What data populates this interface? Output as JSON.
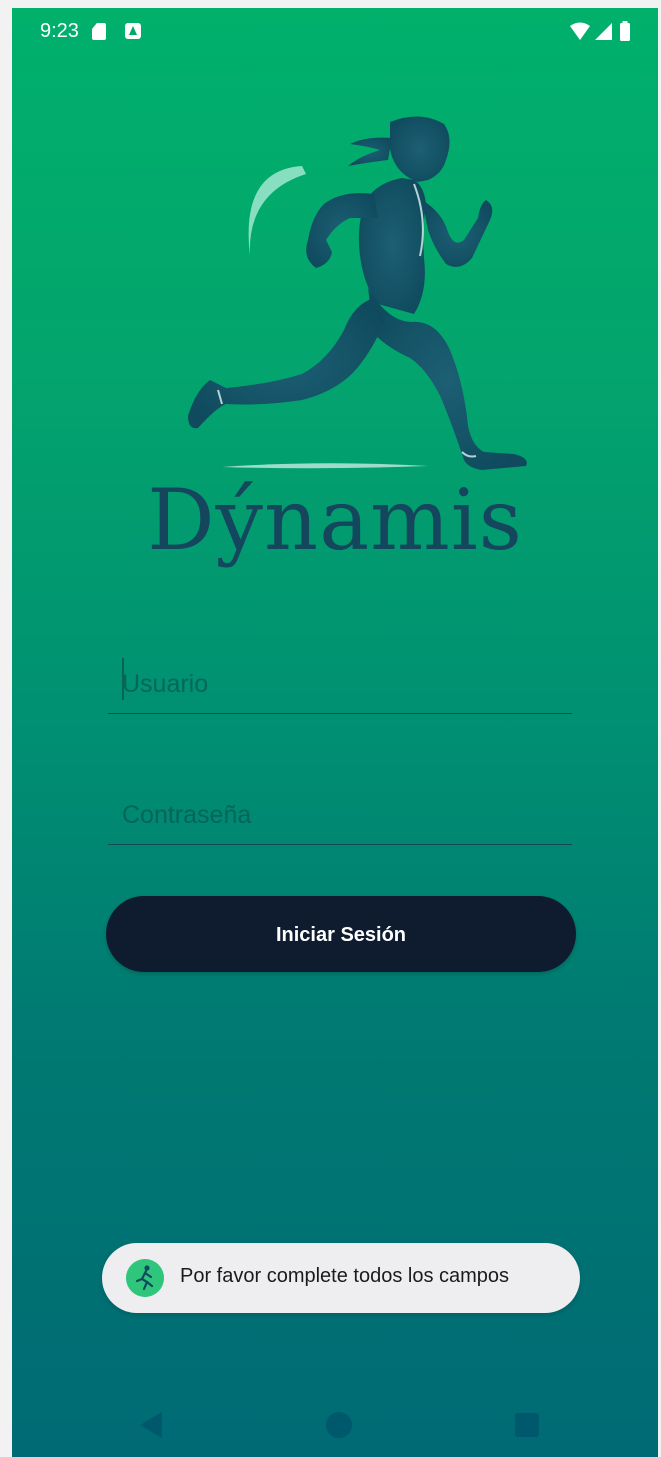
{
  "status_bar": {
    "time": "9:23",
    "icons": [
      "sd-card-icon",
      "notification-icon",
      "wifi-icon",
      "signal-icon",
      "battery-icon"
    ]
  },
  "brand": {
    "name": "Dýnamis",
    "logo_icon": "runner-silhouette-icon",
    "primary_color": "#14465e"
  },
  "login_form": {
    "username_placeholder": "Usuario",
    "username_value": "",
    "password_placeholder": "Contraseña",
    "password_value": "",
    "submit_label": "Iniciar Sesión",
    "button_color": "#0f1b2f"
  },
  "toast": {
    "message": "Por favor complete todos los campos",
    "icon": "app-runner-icon"
  },
  "nav_bar": {
    "icons": [
      "back-icon",
      "home-icon",
      "recents-icon"
    ]
  },
  "theme": {
    "gradient_top": "#00b06b",
    "gradient_bottom": "#006a74"
  }
}
